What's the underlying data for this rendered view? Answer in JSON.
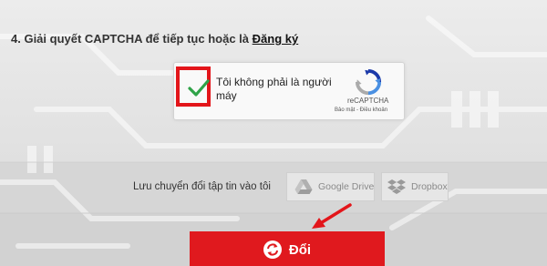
{
  "step": {
    "title": "4. Giải quyết CAPTCHA để tiếp tục hoặc là",
    "link_label": "Đăng ký"
  },
  "captcha": {
    "label": "Tôi không phải là người máy",
    "checked": true,
    "brand": "reCAPTCHA",
    "links": "Bảo mật - Điều khoản"
  },
  "share": {
    "label": "Lưu chuyển đổi tập tin vào tôi",
    "google_drive": "Google Drive",
    "dropbox": "Dropbox"
  },
  "convert": {
    "label": "Đổi"
  },
  "colors": {
    "accent_red": "#e0191e",
    "highlight_red": "#e3151a",
    "check_green": "#2fa348"
  }
}
